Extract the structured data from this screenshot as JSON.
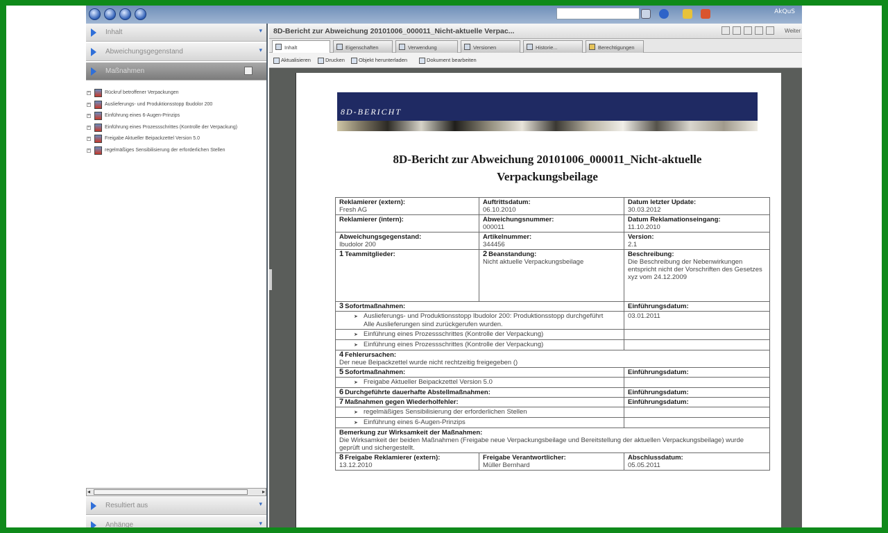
{
  "topbar": {
    "brand": "AkQuS"
  },
  "sidebar": {
    "sections": [
      {
        "label": "Inhalt"
      },
      {
        "label": "Abweichungsgegenstand"
      },
      {
        "label": "Maßnahmen"
      }
    ],
    "tree_items": [
      {
        "label": "Rückruf betroffener Verpackungen"
      },
      {
        "label": "Auslieferungs- und Produktionsstopp Ibudolor 200"
      },
      {
        "label": "Einführung eines 6-Augen-Prinzips"
      },
      {
        "label": "Einführung eines Prozessschrittes (Kontrolle der Verpackung)"
      },
      {
        "label": "Freigabe Aktueller Beipackzettel Version 5.0"
      },
      {
        "label": "regelmäßiges Sensibilisierung der erforderlichen Stellen"
      }
    ],
    "bottom_sections": [
      {
        "label": "Resultiert aus"
      },
      {
        "label": "Anhänge"
      }
    ]
  },
  "document": {
    "title": "8D-Bericht zur Abweichung 20101006_000011_Nicht-aktuelle Verpac...",
    "tabs": [
      {
        "label": "Inhalt"
      },
      {
        "label": "Eigenschaften"
      },
      {
        "label": "Verwendung"
      },
      {
        "label": "Versionen"
      },
      {
        "label": "Historie..."
      },
      {
        "label": "Berechtigungen"
      }
    ],
    "toolbar": [
      {
        "label": "Aktualisieren"
      },
      {
        "label": "Drucken"
      },
      {
        "label": "Objekt herunterladen"
      },
      {
        "label": "Dokument bearbeiten"
      }
    ],
    "more_label": "Weiter"
  },
  "report": {
    "banner": "8D-BERICHT",
    "heading_line1": "8D-Bericht zur  Abweichung 20101006_000011_Nicht-aktuelle",
    "heading_line2": "Verpackungsbeilage",
    "r1": {
      "c1_label": "Reklamierer (extern):",
      "c1_value": "Fresh AG",
      "c2_label": "Auftrittsdatum:",
      "c2_value": "06.10.2010",
      "c3_label": "Datum letzter Update:",
      "c3_value": "30.03.2012"
    },
    "r2": {
      "c1_label": "Reklamierer (intern):",
      "c2_label": "Abweichungsnummer:",
      "c2_value": "000011",
      "c3_label": "Datum Reklamationseingang:",
      "c3_value": "11.10.2010"
    },
    "r3": {
      "c1_label": "Abweichungsgegenstand:",
      "c1_value": "Ibudolor 200",
      "c2_label": "Artikelnummer:",
      "c2_value": "344456",
      "c3_label": "Version:",
      "c3_value": "2.1"
    },
    "r4": {
      "c1_num": "1",
      "c1_label": "Teammitglieder:",
      "c2_num": "2",
      "c2_label": "Beanstandung:",
      "c2_value": "Nicht aktuelle Verpackungsbeilage",
      "c3_label": "Beschreibung:",
      "c3_value": "Die Beschreibung der Nebenwirkungen entspricht nicht der Vorschriften des Gesetzes xyz vom 24.12.2009"
    },
    "s3": {
      "num": "3",
      "label": "Sofortmaßnahmen:",
      "date_label": "Einführungsdatum:",
      "items": [
        {
          "text": "Auslieferungs- und Produktionsstopp Ibudolor 200: Produktionsstopp durchgeführt",
          "note": "Alle Auslieferungen sind zurückgerufen wurden.",
          "date": "03.01.2011"
        },
        {
          "text": "Einführung eines Prozessschrittes (Kontrolle der Verpackung)",
          "note": "",
          "date": ""
        },
        {
          "text": "Einführung eines Prozessschrittes (Kontrolle der Verpackung)",
          "note": "",
          "date": ""
        }
      ]
    },
    "s4": {
      "num": "4",
      "label": "Fehlerursachen:",
      "text": "Der neue Beipackzettel wurde nicht rechtzeitig freigegeben ()"
    },
    "s5": {
      "num": "5",
      "label": "Sofortmaßnahmen:",
      "date_label": "Einführungsdatum:",
      "items": [
        {
          "text": "Freigabe Aktueller Beipackzettel Version 5.0"
        }
      ]
    },
    "s6": {
      "num": "6",
      "label": "Durchgeführte dauerhafte Abstellmaßnahmen:",
      "date_label": "Einführungsdatum:"
    },
    "s7": {
      "num": "7",
      "label": "Maßnahmen gegen Wiederholfehler:",
      "date_label": "Einführungsdatum:",
      "items": [
        {
          "text": "regelmäßiges Sensibilisierung der erforderlichen Stellen"
        },
        {
          "text": "Einführung eines 6-Augen-Prinzips"
        }
      ]
    },
    "remark": {
      "label": "Bemerkung zur Wirksamkeit der Maßnahmen:",
      "text": "Die Wirksamkeit der beiden Maßnahmen (Freigabe neue Verpackungsbeilage und Bereitstellung der aktuellen Verpackungsbeilage) wurde geprüft und sichergestellt."
    },
    "s8": {
      "num": "8",
      "c1_label": "Freigabe Reklamierer (extern):",
      "c1_value": "13.12.2010",
      "c2_label": "Freigabe Verantwortlicher:",
      "c2_value": "Müller Bernhard",
      "c3_label": "Abschlussdatum:",
      "c3_value": "05.05.2011"
    }
  }
}
